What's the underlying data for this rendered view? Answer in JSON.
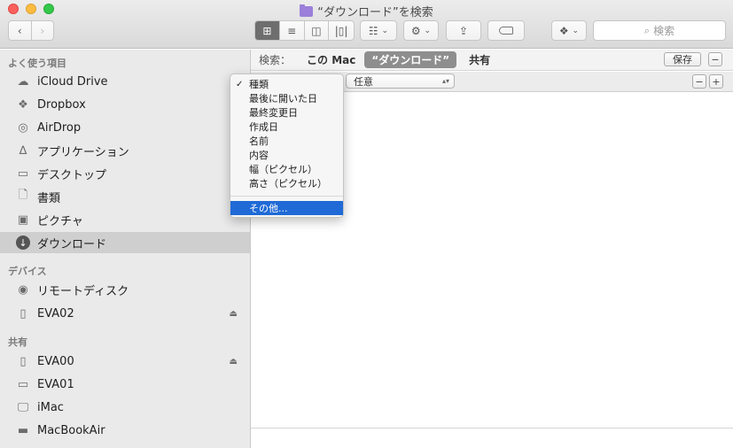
{
  "window": {
    "title": "“ダウンロード”を検索"
  },
  "toolbar": {
    "search_placeholder": "検索"
  },
  "sidebar": {
    "favorites_header": "よく使う項目",
    "favorites": [
      {
        "label": "iCloud Drive",
        "icon": "cloud-icon"
      },
      {
        "label": "Dropbox",
        "icon": "dropbox-icon"
      },
      {
        "label": "AirDrop",
        "icon": "airdrop-icon"
      },
      {
        "label": "アプリケーション",
        "icon": "applications-icon"
      },
      {
        "label": "デスクトップ",
        "icon": "desktop-icon"
      },
      {
        "label": "書類",
        "icon": "documents-icon"
      },
      {
        "label": "ピクチャ",
        "icon": "camera-icon"
      },
      {
        "label": "ダウンロード",
        "icon": "download-icon",
        "selected": true
      }
    ],
    "devices_header": "デバイス",
    "devices": [
      {
        "label": "リモートディスク",
        "icon": "disc-icon"
      },
      {
        "label": "EVA02",
        "icon": "drive-icon",
        "eject": true
      }
    ],
    "shared_header": "共有",
    "shared": [
      {
        "label": "EVA00",
        "icon": "drive-icon",
        "eject": true
      },
      {
        "label": "EVA01",
        "icon": "drive-icon"
      },
      {
        "label": "iMac",
        "icon": "imac-icon"
      },
      {
        "label": "MacBookAir",
        "icon": "laptop-icon"
      }
    ]
  },
  "scopebar": {
    "label": "検索：",
    "this_mac": "この Mac",
    "current_folder": "“ダウンロード”",
    "shared": "共有",
    "save_label": "保存"
  },
  "criteria": {
    "value_selected": "任意"
  },
  "menu": {
    "items": [
      {
        "label": "種類",
        "checked": true
      },
      {
        "label": "最後に開いた日"
      },
      {
        "label": "最終変更日"
      },
      {
        "label": "作成日"
      },
      {
        "label": "名前"
      },
      {
        "label": "内容"
      },
      {
        "label": "幅（ピクセル）"
      },
      {
        "label": "高さ（ピクセル）"
      }
    ],
    "other_label": "その他..."
  }
}
